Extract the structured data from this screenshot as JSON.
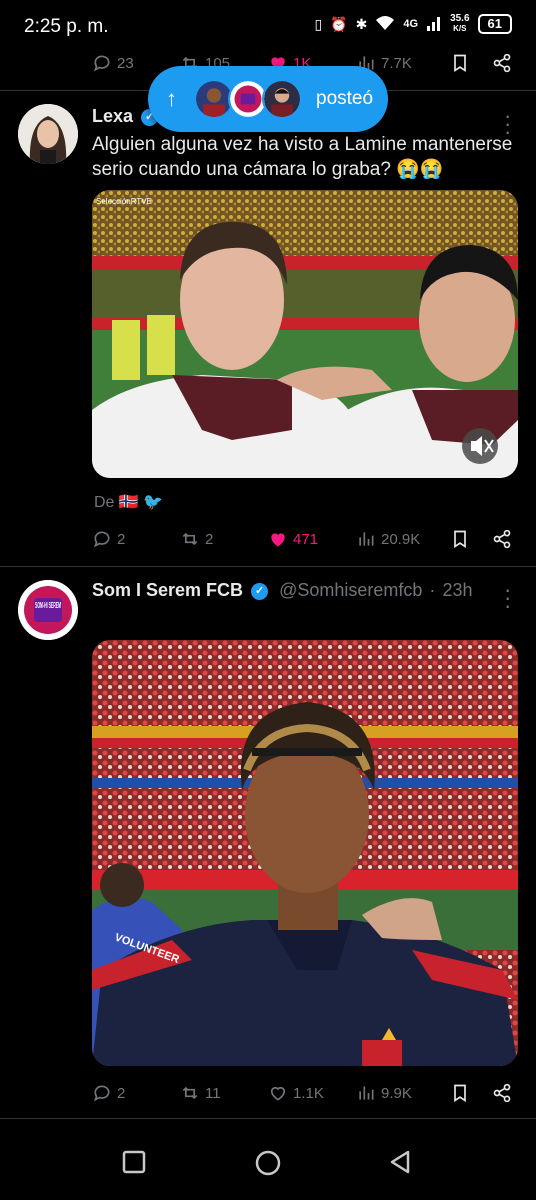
{
  "status_bar": {
    "time": "2:25 p. m.",
    "network_speed": "35.6",
    "network_unit": "K/S",
    "network_type": "4G",
    "battery": "61"
  },
  "prev_tweet_actions": {
    "replies": "23",
    "reposts": "105",
    "likes": "1K",
    "views": "7.7K"
  },
  "posted_pill": {
    "label": "posteó"
  },
  "tweet1": {
    "author": "Lexa",
    "text": "Alguien alguna vez ha visto a Lamine mantenerse serio cuando una cámara lo graba? 😭😭",
    "media_watermark": "SelecciónRTVE",
    "from_label": "De",
    "from_flag": "🇳🇴",
    "replies": "2",
    "reposts": "2",
    "likes": "471",
    "views": "20.9K"
  },
  "tweet2": {
    "author": "Som I Serem FCB",
    "handle": "@Somhiseremfcb",
    "time": "23h",
    "avatar_text": "SOM-HI SEREM",
    "vest_text": "VOLUNTEER",
    "replies": "2",
    "reposts": "11",
    "likes": "1.1K",
    "views": "9.9K"
  },
  "colors": {
    "accent": "#1d9bf0",
    "like": "#f91880",
    "muted": "#71767b",
    "text": "#e7e9ea"
  }
}
